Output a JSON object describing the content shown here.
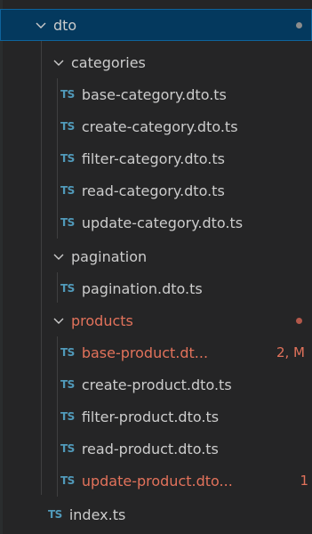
{
  "explorer": {
    "items": [
      {
        "kind": "folder",
        "label": "dto",
        "depth": 0,
        "expanded": true,
        "selected": true,
        "status": "dot-gray"
      },
      {
        "kind": "folder",
        "label": "categories",
        "depth": 1,
        "expanded": true
      },
      {
        "kind": "file",
        "label": "base-category.dto.ts",
        "depth": 2,
        "icon": "TS"
      },
      {
        "kind": "file",
        "label": "create-category.dto.ts",
        "depth": 2,
        "icon": "TS"
      },
      {
        "kind": "file",
        "label": "filter-category.dto.ts",
        "depth": 2,
        "icon": "TS"
      },
      {
        "kind": "file",
        "label": "read-category.dto.ts",
        "depth": 2,
        "icon": "TS"
      },
      {
        "kind": "file",
        "label": "update-category.dto.ts",
        "depth": 2,
        "icon": "TS"
      },
      {
        "kind": "folder",
        "label": "pagination",
        "depth": 1,
        "expanded": true
      },
      {
        "kind": "file",
        "label": "pagination.dto.ts",
        "depth": 2,
        "icon": "TS"
      },
      {
        "kind": "folder",
        "label": "products",
        "depth": 1,
        "expanded": true,
        "modified": true,
        "status": "dot-red"
      },
      {
        "kind": "file",
        "label": "base-product.dt...",
        "depth": 2,
        "icon": "TS",
        "modified": true,
        "badge": "2, M"
      },
      {
        "kind": "file",
        "label": "create-product.dto.ts",
        "depth": 2,
        "icon": "TS"
      },
      {
        "kind": "file",
        "label": "filter-product.dto.ts",
        "depth": 2,
        "icon": "TS"
      },
      {
        "kind": "file",
        "label": "read-product.dto.ts",
        "depth": 2,
        "icon": "TS"
      },
      {
        "kind": "file",
        "label": "update-product.dto...",
        "depth": 2,
        "icon": "TS",
        "modified": true,
        "badge": "1"
      },
      {
        "kind": "file",
        "label": "index.ts",
        "depth": 1,
        "icon": "TS"
      }
    ]
  },
  "colors": {
    "background": "#252526",
    "selection": "#04395e",
    "ts_icon": "#519aba",
    "modified": "#e2725b"
  }
}
